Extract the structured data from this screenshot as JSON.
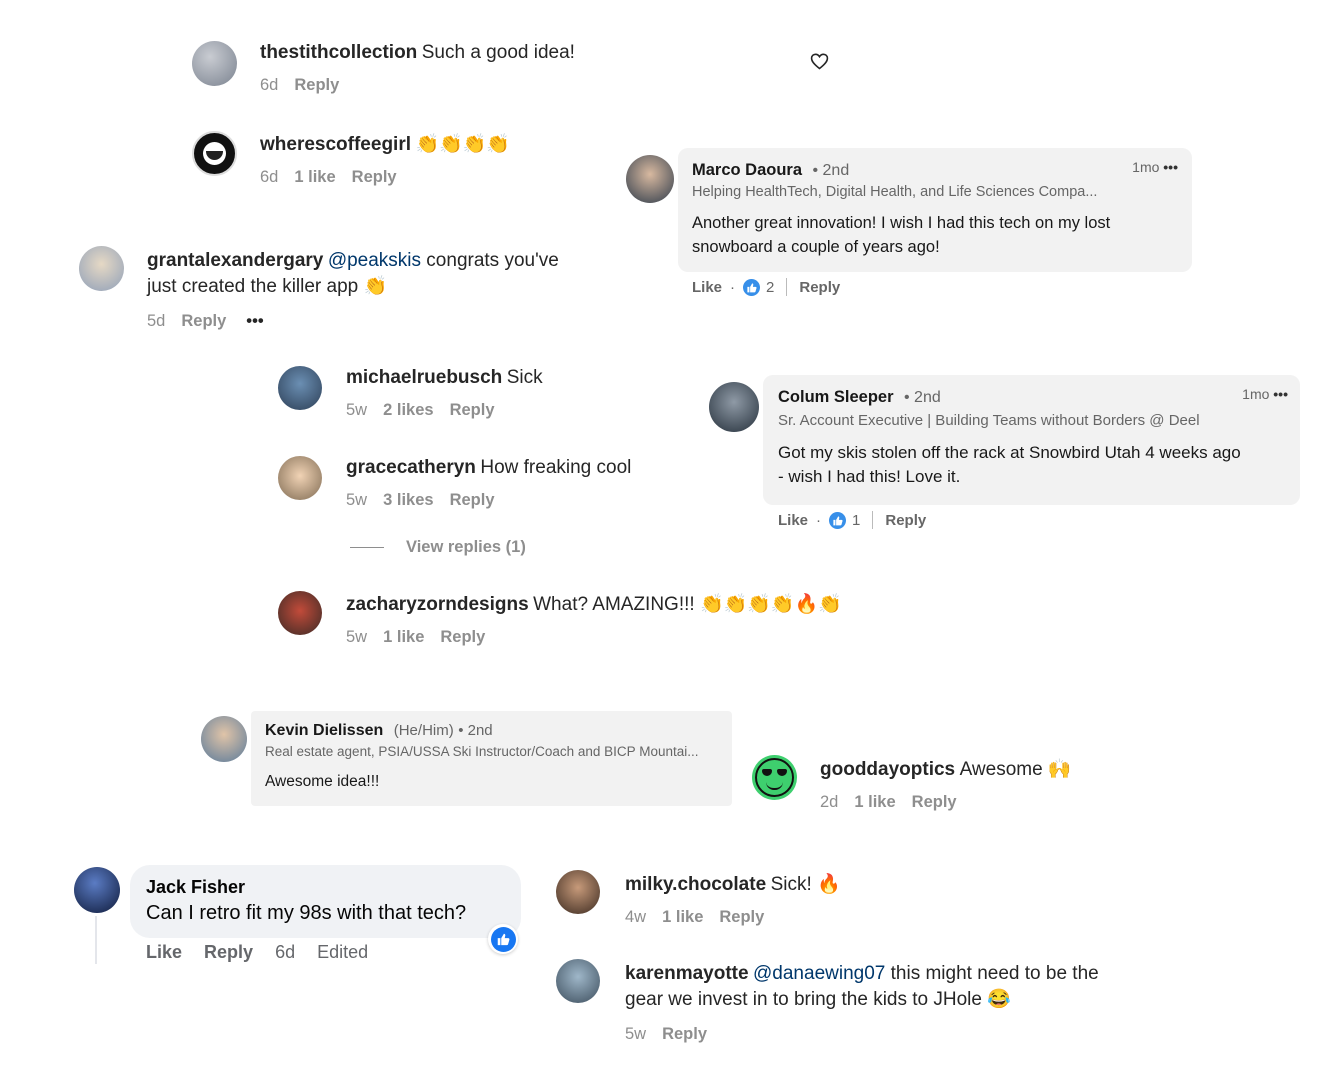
{
  "ig_comments": [
    {
      "user": "thestithcollection",
      "text": "Such a good idea!",
      "time": "6d",
      "likes": "",
      "reply": "Reply"
    },
    {
      "user": "wherescoffeegirl",
      "text": "👏👏👏👏",
      "time": "6d",
      "likes": "1 like",
      "reply": "Reply"
    },
    {
      "user": "grantalexandergary",
      "mention": "@peakskis",
      "text1": " congrats you've",
      "text2": "just created the killer app 👏",
      "time": "5d",
      "reply": "Reply",
      "more": "•••"
    },
    {
      "user": "michaelruebusch",
      "text": "Sick",
      "time": "5w",
      "likes": "2 likes",
      "reply": "Reply"
    },
    {
      "user": "gracecatheryn",
      "text": "How freaking cool",
      "time": "5w",
      "likes": "3 likes",
      "reply": "Reply"
    },
    {
      "view_replies": "View replies (1)"
    },
    {
      "user": "zacharyzorndesigns",
      "text": "What? AMAZING!!! 👏👏👏👏🔥👏",
      "time": "5w",
      "likes": "1 like",
      "reply": "Reply"
    },
    {
      "user": "gooddayoptics",
      "text": "Awesome 🙌",
      "time": "2d",
      "likes": "1 like",
      "reply": "Reply"
    },
    {
      "user": "milky.chocolate",
      "text": "Sick! 🔥",
      "time": "4w",
      "likes": "1 like",
      "reply": "Reply"
    },
    {
      "user": "karenmayotte",
      "mention": "@danaewing07",
      "text1": " this might need to be the",
      "text2": "gear we invest in to bring the kids to JHole 😂",
      "time": "5w",
      "reply": "Reply"
    }
  ],
  "li_comments": [
    {
      "name": "Marco Daoura",
      "degree": "• 2nd",
      "headline": "Helping HealthTech, Digital Health, and Life Sciences Compa...",
      "time": "1mo",
      "more": "•••",
      "body1": "Another great innovation! I wish I had this tech on my lost",
      "body2": "snowboard a couple of years ago!",
      "like": "Like",
      "dot": "·",
      "count": "2",
      "reply": "Reply"
    },
    {
      "name": "Colum Sleeper",
      "degree": "• 2nd",
      "headline": "Sr. Account Executive | Building Teams without Borders @ Deel",
      "time": "1mo",
      "more": "•••",
      "body1": "Got my skis stolen off the rack at Snowbird Utah 4 weeks ago",
      "body2": "- wish I had this! Love it.",
      "like": "Like",
      "dot": "·",
      "count": "1",
      "reply": "Reply"
    },
    {
      "name": "Kevin Dielissen",
      "pronouns": "(He/Him)",
      "degree": "• 2nd",
      "headline": "Real estate agent, PSIA/USSA Ski Instructor/Coach and BICP Mountai...",
      "body1": "Awesome idea!!!"
    }
  ],
  "fb_comment": {
    "name": "Jack Fisher",
    "text": "Can I retro fit my 98s with that tech?",
    "like": "Like",
    "reply": "Reply",
    "time": "6d",
    "edited": "Edited"
  },
  "colors": {
    "li_like": "#378fe9",
    "fb_like": "#1877f2",
    "mention": "#00376b"
  }
}
